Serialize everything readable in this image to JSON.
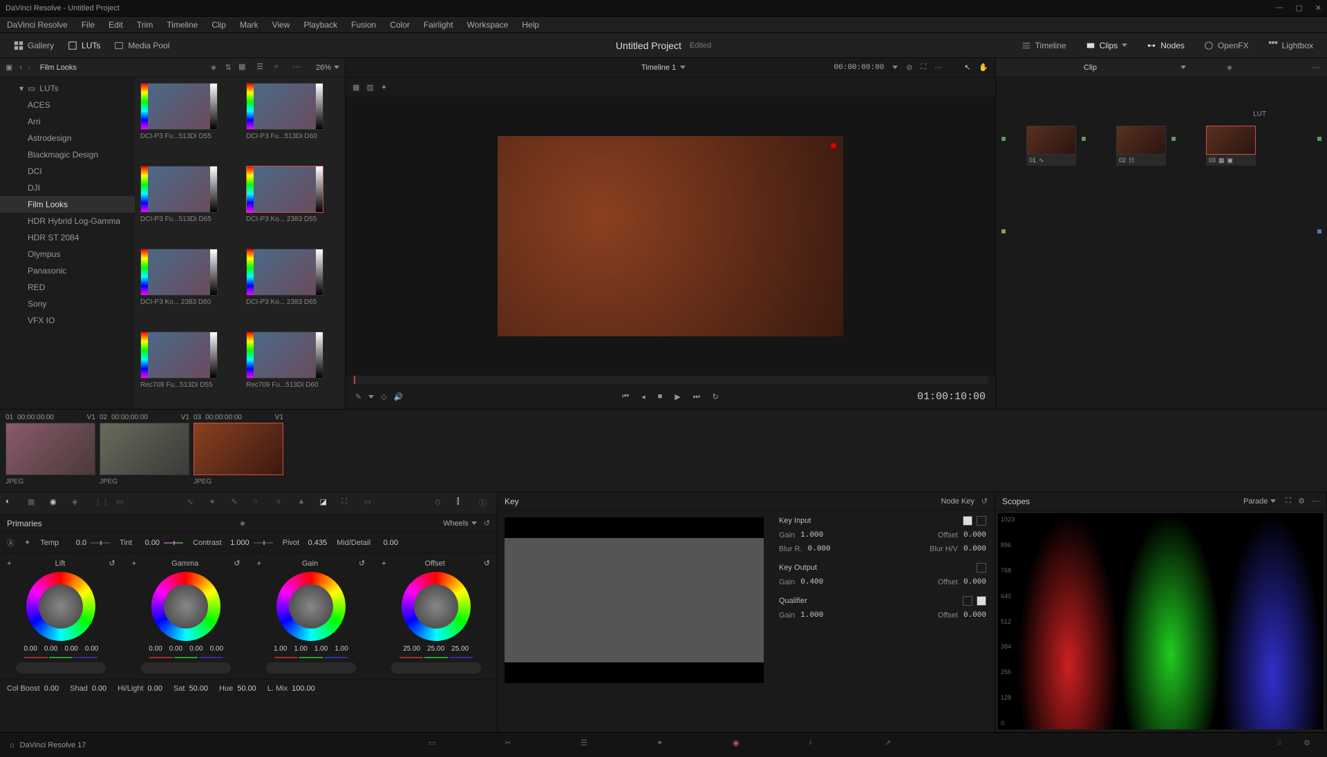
{
  "window": {
    "title": "DaVinci Resolve - Untitled Project"
  },
  "menu": [
    "DaVinci Resolve",
    "File",
    "Edit",
    "Trim",
    "Timeline",
    "Clip",
    "Mark",
    "View",
    "Playback",
    "Fusion",
    "Color",
    "Fairlight",
    "Workspace",
    "Help"
  ],
  "toptoolbar": {
    "gallery": "Gallery",
    "luts": "LUTs",
    "mediapool": "Media Pool",
    "project": "Untitled Project",
    "status": "Edited",
    "timeline": "Timeline",
    "clips": "Clips",
    "nodes": "Nodes",
    "openfx": "OpenFX",
    "lightbox": "Lightbox"
  },
  "luts_panel": {
    "path": "Film Looks",
    "zoom": "26%",
    "root": "LUTs",
    "folders": [
      "ACES",
      "Arri",
      "Astrodesign",
      "Blackmagic Design",
      "DCI",
      "DJI",
      "Film Looks",
      "HDR Hybrid Log-Gamma",
      "HDR ST 2084",
      "Olympus",
      "Panasonic",
      "RED",
      "Sony",
      "VFX IO"
    ],
    "selected_folder": "Film Looks",
    "thumbs": [
      "DCI-P3 Fu...513Di D55",
      "DCI-P3 Fu...513Di D60",
      "DCI-P3 Fu...513Di D65",
      "DCI-P3 Ko... 2383 D55",
      "DCI-P3 Ko... 2383 D60",
      "DCI-P3 Ko... 2383 D65",
      "Rec709 Fu...513Di D55",
      "Rec709 Fu...513Di D60"
    ],
    "selected_thumb": 3
  },
  "viewer": {
    "timeline_name": "Timeline 1",
    "tc": "00:00:00:00",
    "tc_big": "01:00:10:00"
  },
  "nodes": {
    "mode": "Clip",
    "label": "LUT",
    "items": [
      {
        "num": "01"
      },
      {
        "num": "02"
      },
      {
        "num": "03"
      }
    ]
  },
  "clips": [
    {
      "num": "01",
      "tc": "00:00:00:00",
      "track": "V1",
      "type": "JPEG"
    },
    {
      "num": "02",
      "tc": "00:00:00:00",
      "track": "V1",
      "type": "JPEG"
    },
    {
      "num": "03",
      "tc": "00:00:00:00",
      "track": "V1",
      "type": "JPEG"
    }
  ],
  "selected_clip": 2,
  "primaries": {
    "title": "Primaries",
    "mode": "Wheels",
    "top": {
      "temp_label": "Temp",
      "temp": "0.0",
      "tint_label": "Tint",
      "tint": "0.00",
      "contrast_label": "Contrast",
      "contrast": "1.000",
      "pivot_label": "Pivot",
      "pivot": "0.435",
      "md_label": "Mid/Detail",
      "md": "0.00"
    },
    "wheels": [
      {
        "name": "Lift",
        "vals": [
          "0.00",
          "0.00",
          "0.00",
          "0.00"
        ]
      },
      {
        "name": "Gamma",
        "vals": [
          "0.00",
          "0.00",
          "0.00",
          "0.00"
        ]
      },
      {
        "name": "Gain",
        "vals": [
          "1.00",
          "1.00",
          "1.00",
          "1.00"
        ]
      },
      {
        "name": "Offset",
        "vals": [
          "25.00",
          "25.00",
          "25.00"
        ]
      }
    ],
    "bottom": {
      "cb_label": "Col Boost",
      "cb": "0.00",
      "shad_label": "Shad",
      "shad": "0.00",
      "hl_label": "Hi/Light",
      "hl": "0.00",
      "sat_label": "Sat",
      "sat": "50.00",
      "hue_label": "Hue",
      "hue": "50.00",
      "lm_label": "L. Mix",
      "lm": "100.00"
    }
  },
  "key": {
    "title": "Key",
    "mode": "Node Key",
    "input": {
      "title": "Key Input",
      "gain_l": "Gain",
      "gain": "1.000",
      "offset_l": "Offset",
      "offset": "0.000",
      "blur_l": "Blur R.",
      "blur": "0.000",
      "blurhv_l": "Blur H/V",
      "blurhv": "0.000"
    },
    "output": {
      "title": "Key Output",
      "gain_l": "Gain",
      "gain": "0.400",
      "offset_l": "Offset",
      "offset": "0.000"
    },
    "qualifier": {
      "title": "Qualifier",
      "gain_l": "Gain",
      "gain": "1.000",
      "offset_l": "Offset",
      "offset": "0.000"
    }
  },
  "scopes": {
    "title": "Scopes",
    "mode": "Parade",
    "labels": [
      "1023",
      "896",
      "768",
      "640",
      "512",
      "384",
      "256",
      "128",
      "0"
    ]
  },
  "footer": {
    "app": "DaVinci Resolve 17"
  }
}
